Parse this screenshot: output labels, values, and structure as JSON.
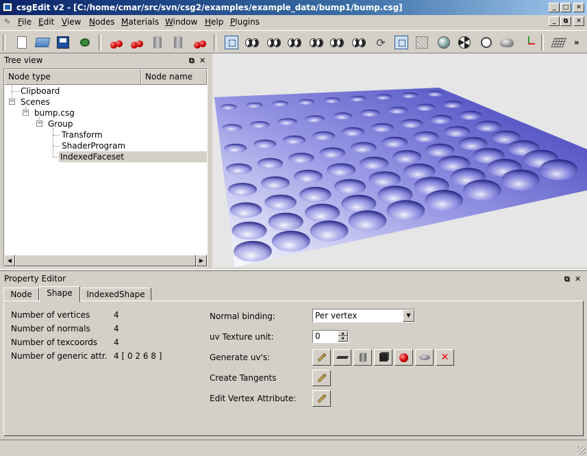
{
  "window": {
    "title": "csgEdit v2 - [C:/home/cmar/src/svn/csg2/examples/example_data/bump1/bump.csg]"
  },
  "menu": {
    "items": [
      "File",
      "Edit",
      "View",
      "Nodes",
      "Materials",
      "Window",
      "Help",
      "Plugins"
    ]
  },
  "toolbar": {
    "overflow": "»",
    "buttons": [
      "new-document-icon",
      "open-folder-icon",
      "save-disk-icon",
      "bug-icon",
      "cherries-icon",
      "copy-cherries-icon",
      "can-icon",
      "paste-can-icon",
      "delete-cherries-icon",
      "camera-icon",
      "eyes-icon",
      "eyes-icon",
      "eyes-icon",
      "eyes-icon",
      "eyes-icon",
      "eyes-icon",
      "rotate-icon",
      "fit-view-icon",
      "wireframe-icon",
      "sphere-icon",
      "radiation-icon",
      "stopwatch-icon",
      "teapot-icon",
      "axes-icon",
      "grid-icon"
    ]
  },
  "tree_view": {
    "title": "Tree view",
    "columns": [
      "Node type",
      "Node name"
    ],
    "nodes": [
      "Clipboard",
      "Scenes",
      "bump.csg",
      "Group",
      "Transform",
      "ShaderProgram",
      "IndexedFaceset"
    ],
    "selected": "IndexedFaceset"
  },
  "viewport": {
    "grid_rows": 8,
    "grid_cols": 9,
    "colors": {
      "background": "#e6e6e6",
      "surface_dark": "#3a3ab8",
      "surface_light": "#ffffff"
    }
  },
  "property_editor": {
    "title": "Property Editor",
    "tabs": [
      "Node",
      "Shape",
      "IndexedShape"
    ],
    "active_tab": "Shape",
    "stats": {
      "labels": [
        "Number of vertices",
        "Number of normals",
        "Number of texcoords",
        "Number of generic attr."
      ],
      "values": [
        "4",
        "4",
        "4",
        "4 [ 0 2 6 8 ]"
      ]
    },
    "normal_binding": {
      "label": "Normal binding:",
      "value": "Per vertex"
    },
    "uv_unit": {
      "label": "uv Texture unit:",
      "value": "0"
    },
    "generate_uv": {
      "label": "Generate uv's:",
      "buttons": [
        "pencil-icon",
        "plane-icon",
        "cylinder-icon",
        "cube-icon",
        "sphere-icon",
        "teapot-icon",
        "remove-icon"
      ]
    },
    "create_tangents": {
      "label": "Create Tangents"
    },
    "edit_vertex_attr": {
      "label": "Edit Vertex Attribute:"
    }
  },
  "dock_buttons": {
    "float": "⧉",
    "close": "✕"
  },
  "window_buttons": {
    "minimize": "_",
    "maximize": "□",
    "close": "✕"
  }
}
